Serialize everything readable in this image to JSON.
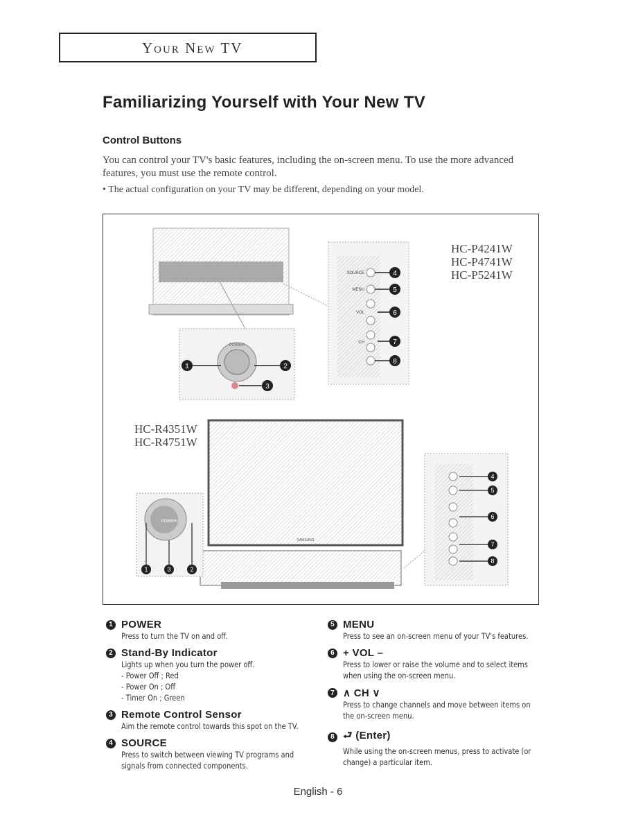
{
  "header": {
    "section": "Your New TV"
  },
  "title": "Familiarizing Yourself with Your New TV",
  "subtitle": "Control Buttons",
  "intro": "You can control your TV's basic features, including the on-screen menu. To use the more advanced features, you must use the remote control.",
  "note": "• The actual configuration on your TV may be different, depending on your model.",
  "diagram": {
    "models_top": [
      "HC-P4241W",
      "HC-P4741W",
      "HC-P5241W"
    ],
    "models_bottom": [
      "HC-R4351W",
      "HC-R4751W"
    ],
    "panel_labels": [
      "SOURCE",
      "MENU",
      "VOL",
      "CH",
      "POWER",
      "SAMSUNG"
    ]
  },
  "items": [
    {
      "num": "1",
      "title": "POWER",
      "lines": [
        "Press to turn the TV on and off."
      ]
    },
    {
      "num": "2",
      "title": "Stand-By Indicator",
      "lines": [
        "Lights up when you turn the power off.",
        "- Power Off ; Red",
        "- Power On ; Off",
        "- Timer On ; Green"
      ]
    },
    {
      "num": "3",
      "title": "Remote Control Sensor",
      "lines": [
        "Aim the remote control towards this spot on the TV."
      ]
    },
    {
      "num": "4",
      "title": "SOURCE",
      "lines": [
        "Press to switch between viewing TV programs and",
        "signals from connected components."
      ]
    },
    {
      "num": "5",
      "title": "MENU",
      "lines": [
        "Press to see an on-screen menu of your TV's features."
      ]
    },
    {
      "num": "6",
      "title": "+ VOL –",
      "lines": [
        "Press to lower or raise the volume and to select items",
        "when using the on-screen menu."
      ]
    },
    {
      "num": "7",
      "title": "∧ CH ∨",
      "lines": [
        "Press to change channels and move between items on",
        "the on-screen menu."
      ]
    },
    {
      "num": "8",
      "title": "⮐ (Enter)",
      "lines": [
        "While using the on-screen menus, press to activate (or",
        "change) a particular item."
      ]
    }
  ],
  "footer": "English - 6"
}
